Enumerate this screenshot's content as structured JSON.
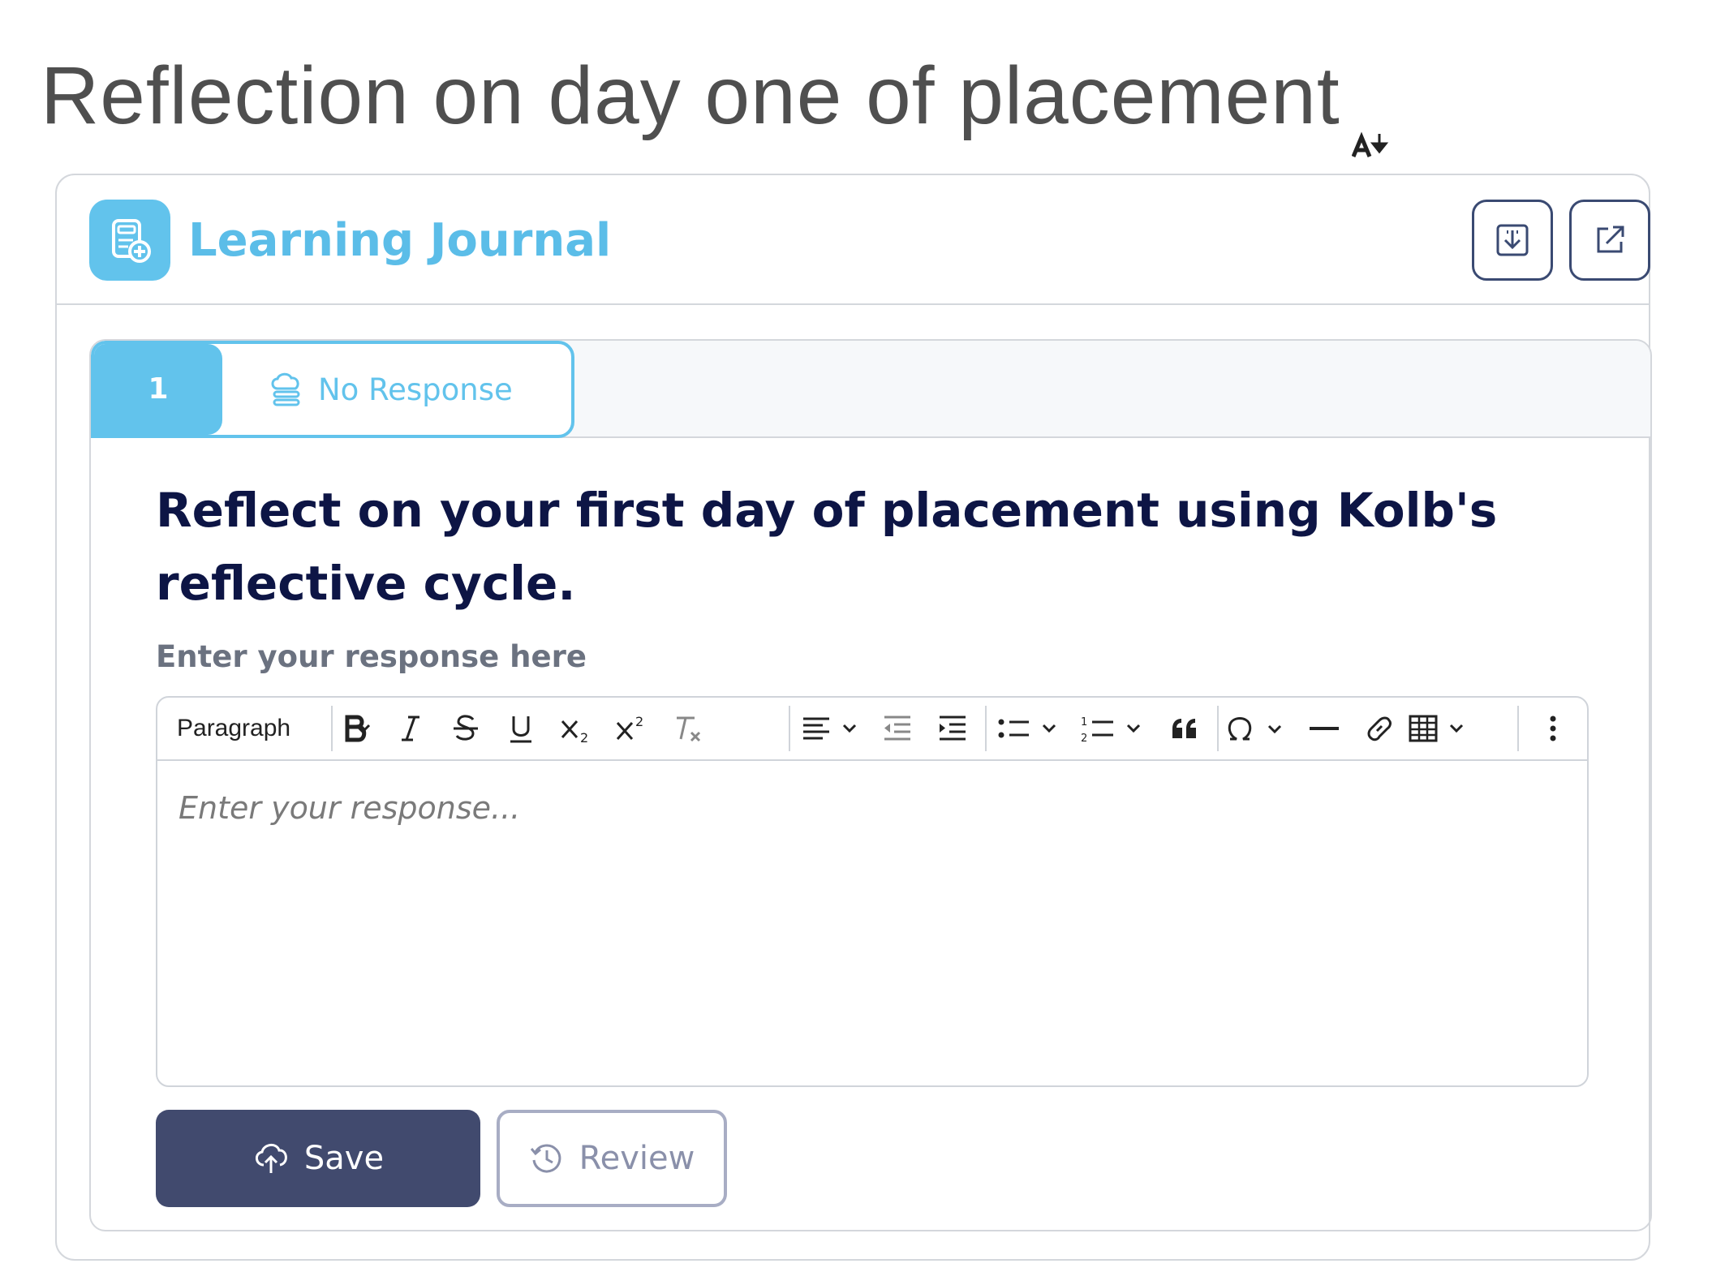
{
  "page": {
    "title": "Reflection on day one of placement"
  },
  "journal": {
    "title": "Learning Journal",
    "download_button": "download-icon",
    "open_button": "external-link-icon"
  },
  "question": {
    "number": "1",
    "status": "No Response",
    "text": "Reflect on your first day of placement using Kolb's reflective cycle.",
    "response_label": "Enter your response here"
  },
  "editor": {
    "format_value": "Paragraph",
    "placeholder": "Enter your response..."
  },
  "actions": {
    "save_label": "Save",
    "review_label": "Review"
  },
  "colors": {
    "accent": "#62c3ec",
    "heading": "#0d1545",
    "primary_button": "#414a6e"
  }
}
